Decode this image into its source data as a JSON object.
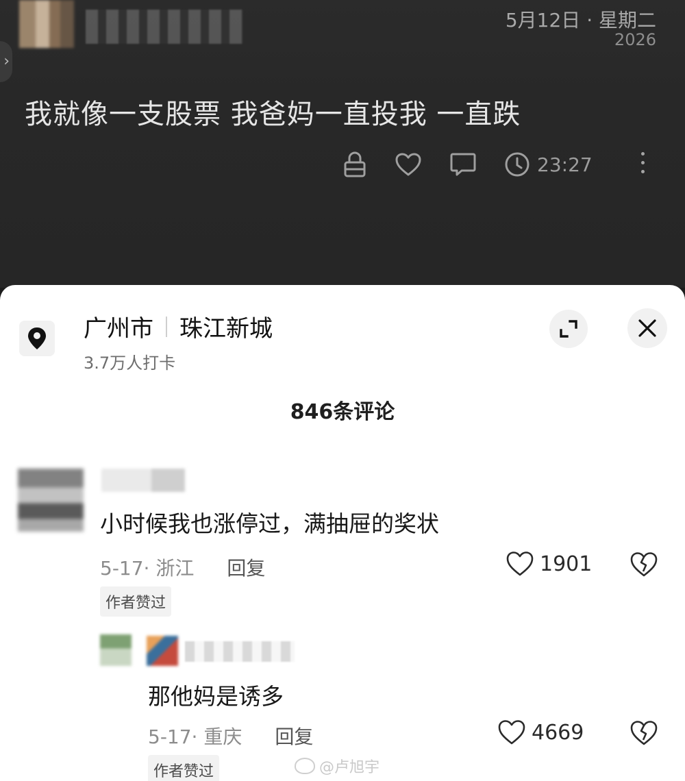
{
  "post": {
    "date": "5月12日 · 星期二",
    "year": "2026",
    "text": "我就像一支股票 我爸妈一直投我 一直跌",
    "time": "23:27"
  },
  "location": {
    "city": "广州市",
    "area": "珠江新城",
    "checkins": "3.7万人打卡"
  },
  "comments_header": "846条评论",
  "comments": [
    {
      "text": "小时候我也涨停过，满抽屉的奖状",
      "meta": "5-17· 浙江",
      "reply_label": "回复",
      "author_badge": "作者赞过",
      "likes": "1901"
    },
    {
      "text": "那他妈是诱多",
      "meta": "5-17· 重庆",
      "reply_label": "回复",
      "author_badge": "作者赞过",
      "likes": "4669"
    }
  ],
  "watermark": "@卢旭宇",
  "colors": {
    "dark_bg": "#282828",
    "sheet_bg": "#ffffff",
    "muted_text": "#8c8c8c"
  },
  "icons": [
    "lock-icon",
    "heart-icon",
    "comment-icon",
    "clock-icon",
    "more-icon",
    "location-pin-icon",
    "expand-icon",
    "close-icon",
    "broken-heart-icon"
  ]
}
